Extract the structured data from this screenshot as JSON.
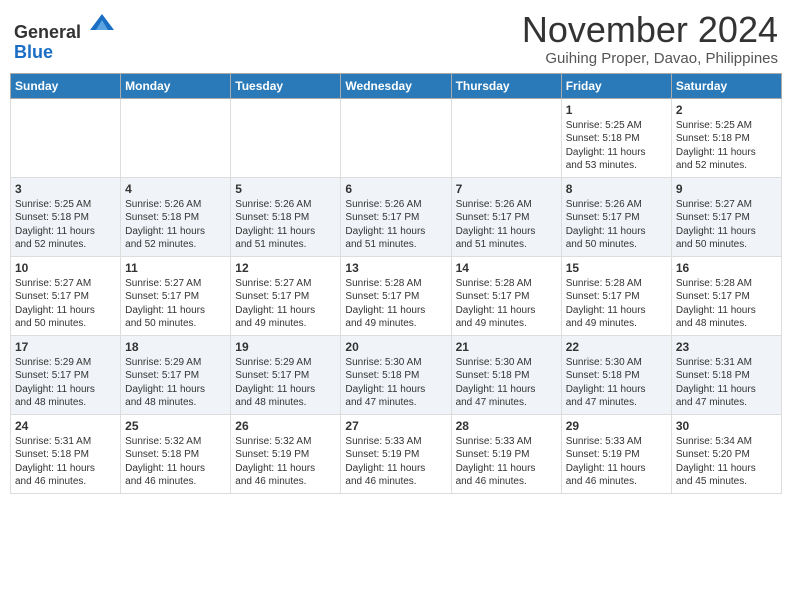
{
  "header": {
    "logo_line1": "General",
    "logo_line2": "Blue",
    "month": "November 2024",
    "location": "Guihing Proper, Davao, Philippines"
  },
  "days_of_week": [
    "Sunday",
    "Monday",
    "Tuesday",
    "Wednesday",
    "Thursday",
    "Friday",
    "Saturday"
  ],
  "weeks": [
    [
      {
        "day": "",
        "info": ""
      },
      {
        "day": "",
        "info": ""
      },
      {
        "day": "",
        "info": ""
      },
      {
        "day": "",
        "info": ""
      },
      {
        "day": "",
        "info": ""
      },
      {
        "day": "1",
        "info": "Sunrise: 5:25 AM\nSunset: 5:18 PM\nDaylight: 11 hours\nand 53 minutes."
      },
      {
        "day": "2",
        "info": "Sunrise: 5:25 AM\nSunset: 5:18 PM\nDaylight: 11 hours\nand 52 minutes."
      }
    ],
    [
      {
        "day": "3",
        "info": "Sunrise: 5:25 AM\nSunset: 5:18 PM\nDaylight: 11 hours\nand 52 minutes."
      },
      {
        "day": "4",
        "info": "Sunrise: 5:26 AM\nSunset: 5:18 PM\nDaylight: 11 hours\nand 52 minutes."
      },
      {
        "day": "5",
        "info": "Sunrise: 5:26 AM\nSunset: 5:18 PM\nDaylight: 11 hours\nand 51 minutes."
      },
      {
        "day": "6",
        "info": "Sunrise: 5:26 AM\nSunset: 5:17 PM\nDaylight: 11 hours\nand 51 minutes."
      },
      {
        "day": "7",
        "info": "Sunrise: 5:26 AM\nSunset: 5:17 PM\nDaylight: 11 hours\nand 51 minutes."
      },
      {
        "day": "8",
        "info": "Sunrise: 5:26 AM\nSunset: 5:17 PM\nDaylight: 11 hours\nand 50 minutes."
      },
      {
        "day": "9",
        "info": "Sunrise: 5:27 AM\nSunset: 5:17 PM\nDaylight: 11 hours\nand 50 minutes."
      }
    ],
    [
      {
        "day": "10",
        "info": "Sunrise: 5:27 AM\nSunset: 5:17 PM\nDaylight: 11 hours\nand 50 minutes."
      },
      {
        "day": "11",
        "info": "Sunrise: 5:27 AM\nSunset: 5:17 PM\nDaylight: 11 hours\nand 50 minutes."
      },
      {
        "day": "12",
        "info": "Sunrise: 5:27 AM\nSunset: 5:17 PM\nDaylight: 11 hours\nand 49 minutes."
      },
      {
        "day": "13",
        "info": "Sunrise: 5:28 AM\nSunset: 5:17 PM\nDaylight: 11 hours\nand 49 minutes."
      },
      {
        "day": "14",
        "info": "Sunrise: 5:28 AM\nSunset: 5:17 PM\nDaylight: 11 hours\nand 49 minutes."
      },
      {
        "day": "15",
        "info": "Sunrise: 5:28 AM\nSunset: 5:17 PM\nDaylight: 11 hours\nand 49 minutes."
      },
      {
        "day": "16",
        "info": "Sunrise: 5:28 AM\nSunset: 5:17 PM\nDaylight: 11 hours\nand 48 minutes."
      }
    ],
    [
      {
        "day": "17",
        "info": "Sunrise: 5:29 AM\nSunset: 5:17 PM\nDaylight: 11 hours\nand 48 minutes."
      },
      {
        "day": "18",
        "info": "Sunrise: 5:29 AM\nSunset: 5:17 PM\nDaylight: 11 hours\nand 48 minutes."
      },
      {
        "day": "19",
        "info": "Sunrise: 5:29 AM\nSunset: 5:17 PM\nDaylight: 11 hours\nand 48 minutes."
      },
      {
        "day": "20",
        "info": "Sunrise: 5:30 AM\nSunset: 5:18 PM\nDaylight: 11 hours\nand 47 minutes."
      },
      {
        "day": "21",
        "info": "Sunrise: 5:30 AM\nSunset: 5:18 PM\nDaylight: 11 hours\nand 47 minutes."
      },
      {
        "day": "22",
        "info": "Sunrise: 5:30 AM\nSunset: 5:18 PM\nDaylight: 11 hours\nand 47 minutes."
      },
      {
        "day": "23",
        "info": "Sunrise: 5:31 AM\nSunset: 5:18 PM\nDaylight: 11 hours\nand 47 minutes."
      }
    ],
    [
      {
        "day": "24",
        "info": "Sunrise: 5:31 AM\nSunset: 5:18 PM\nDaylight: 11 hours\nand 46 minutes."
      },
      {
        "day": "25",
        "info": "Sunrise: 5:32 AM\nSunset: 5:18 PM\nDaylight: 11 hours\nand 46 minutes."
      },
      {
        "day": "26",
        "info": "Sunrise: 5:32 AM\nSunset: 5:19 PM\nDaylight: 11 hours\nand 46 minutes."
      },
      {
        "day": "27",
        "info": "Sunrise: 5:33 AM\nSunset: 5:19 PM\nDaylight: 11 hours\nand 46 minutes."
      },
      {
        "day": "28",
        "info": "Sunrise: 5:33 AM\nSunset: 5:19 PM\nDaylight: 11 hours\nand 46 minutes."
      },
      {
        "day": "29",
        "info": "Sunrise: 5:33 AM\nSunset: 5:19 PM\nDaylight: 11 hours\nand 46 minutes."
      },
      {
        "day": "30",
        "info": "Sunrise: 5:34 AM\nSunset: 5:20 PM\nDaylight: 11 hours\nand 45 minutes."
      }
    ]
  ]
}
